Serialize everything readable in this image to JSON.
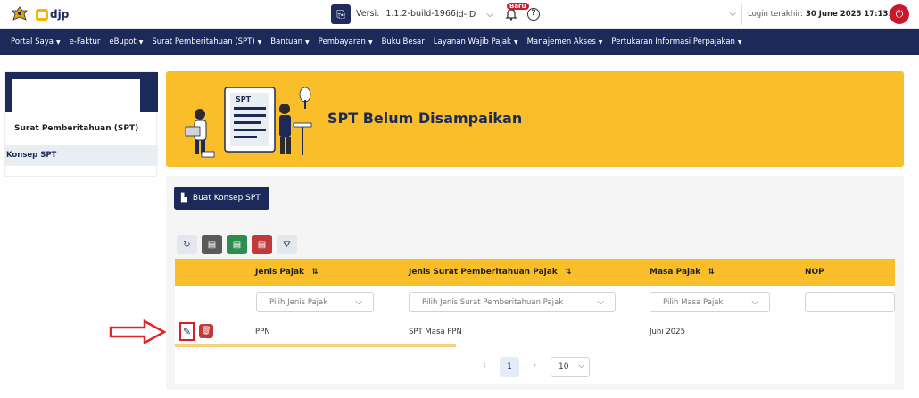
{
  "topbar": {
    "logo_text": "djp",
    "version_label": "Versi:",
    "version_value": "1.1.2-build-1966",
    "language": "id-ID",
    "badge_new": "Baru",
    "login_label": "Login terakhir:",
    "login_value": "30 June 2025 17:13:17"
  },
  "nav": {
    "items": [
      {
        "label": "Portal Saya",
        "caret": true
      },
      {
        "label": "e-Faktur",
        "caret": false
      },
      {
        "label": "eBupot",
        "caret": true
      },
      {
        "label": "Surat Pemberitahuan (SPT)",
        "caret": true
      },
      {
        "label": "Bantuan",
        "caret": true
      },
      {
        "label": "Pembayaran",
        "caret": true
      },
      {
        "label": "Buku Besar",
        "caret": false
      },
      {
        "label": "Layanan Wajib Pajak",
        "caret": true
      },
      {
        "label": "Manajemen Akses",
        "caret": true
      },
      {
        "label": "Pertukaran Informasi Perpajakan",
        "caret": true
      }
    ]
  },
  "sidebar": {
    "section": "Surat Pemberitahuan (SPT)",
    "active_item": "Konsep SPT"
  },
  "banner": {
    "title": "SPT Belum Disampaikan",
    "doc_label": "SPT"
  },
  "actions": {
    "create_button": "Buat Konsep SPT"
  },
  "table": {
    "columns": [
      {
        "label": "Jenis Pajak",
        "sort": "⇅"
      },
      {
        "label": "Jenis Surat Pemberitahuan Pajak",
        "sort": "⇅"
      },
      {
        "label": "Masa Pajak",
        "sort": "⇅"
      },
      {
        "label": "NOP",
        "sort": ""
      }
    ],
    "filters": {
      "jenis_pajak": "Pilih Jenis Pajak",
      "jenis_spt": "Pilih Jenis Surat Pemberitahuan Pajak",
      "masa_pajak": "Pilih Masa Pajak"
    },
    "rows": [
      {
        "jenis_pajak": "PPN",
        "jenis_spt": "SPT Masa PPN",
        "masa_pajak": "Juni 2025",
        "nop": ""
      }
    ],
    "load_progress": 0.39
  },
  "pagination": {
    "current_page": "1",
    "page_size": "10"
  },
  "colors": {
    "navy": "#1c2a5a",
    "yellow": "#f9be2a",
    "red": "#c8192a"
  },
  "icons": [
    "emblem-icon",
    "version-icon",
    "bell-icon",
    "help-icon",
    "logout-icon",
    "file-plus-icon",
    "refresh-icon",
    "file-icon",
    "excel-icon",
    "pdf-icon",
    "filter-icon",
    "pencil-icon",
    "trash-icon",
    "arrow-right-icon"
  ]
}
